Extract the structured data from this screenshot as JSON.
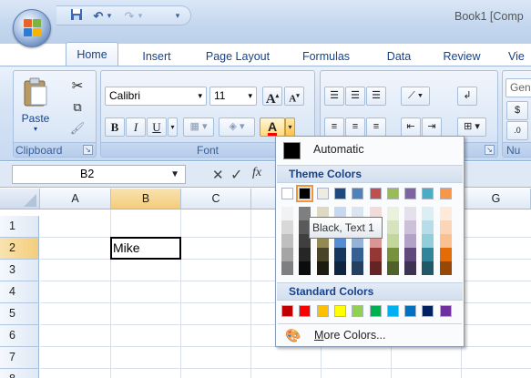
{
  "window": {
    "title": "Book1 [Comp"
  },
  "qat": {
    "save_icon": "save-icon",
    "undo_arrow": "▾",
    "redo_arrow": "▾",
    "customize": "▾"
  },
  "tabs": [
    "Home",
    "Insert",
    "Page Layout",
    "Formulas",
    "Data",
    "Review",
    "Vie"
  ],
  "clipboard": {
    "paste_label": "Paste",
    "group_label": "Clipboard"
  },
  "font": {
    "name": "Calibri",
    "size": "11",
    "bold": "B",
    "italic": "I",
    "underline": "U",
    "grow": "A",
    "shrink": "A",
    "color_glyph": "A",
    "group_label": "Font",
    "font_color": "#ff0000"
  },
  "number": {
    "format_value": "Gen",
    "group_label": "Nu"
  },
  "formula_bar": {
    "name_box": "B2",
    "fx": "fx"
  },
  "grid": {
    "columns": [
      "A",
      "B",
      "C",
      "D",
      "E",
      "F",
      "G"
    ],
    "rows": [
      "1",
      "2",
      "3",
      "4",
      "5",
      "6",
      "7",
      "8"
    ],
    "b2_value": "Mike"
  },
  "color_menu": {
    "automatic_label": "Automatic",
    "theme_header": "Theme Colors",
    "standard_header": "Standard Colors",
    "more_colors_label": "More Colors...",
    "more_colors_accel": "M",
    "more_colors_rest": "ore Colors...",
    "tooltip": "Black, Text 1",
    "theme_top": [
      "#ffffff",
      "#000000",
      "#eeece1",
      "#1f497d",
      "#4f81bd",
      "#c0504d",
      "#9bbb59",
      "#8064a2",
      "#4bacc6",
      "#f79646"
    ],
    "theme_shades": [
      [
        "#f2f2f2",
        "#d8d8d8",
        "#bfbfbf",
        "#a5a5a5",
        "#7f7f7f"
      ],
      [
        "#7f7f7f",
        "#595959",
        "#3f3f3f",
        "#262626",
        "#0c0c0c"
      ],
      [
        "#ddd9c3",
        "#c4bd97",
        "#938953",
        "#494429",
        "#1d1b10"
      ],
      [
        "#c6d9f0",
        "#8db3e2",
        "#548dd4",
        "#17365d",
        "#0f243e"
      ],
      [
        "#dbe5f1",
        "#b8cce4",
        "#95b3d7",
        "#366092",
        "#244061"
      ],
      [
        "#f2dcdb",
        "#e5b9b7",
        "#d99694",
        "#953734",
        "#632423"
      ],
      [
        "#ebf1dd",
        "#d7e3bc",
        "#c3d69b",
        "#76923c",
        "#4f6128"
      ],
      [
        "#e5e0ec",
        "#ccc1d9",
        "#b2a2c7",
        "#5f497a",
        "#3f3151"
      ],
      [
        "#dbeef3",
        "#b7dde8",
        "#92cddc",
        "#31859b",
        "#205867"
      ],
      [
        "#fdeada",
        "#fbd5b5",
        "#fac08f",
        "#e36c09",
        "#974806"
      ]
    ],
    "standard": [
      "#c00000",
      "#ff0000",
      "#ffc000",
      "#ffff00",
      "#92d050",
      "#00b050",
      "#00b0f0",
      "#0070c0",
      "#002060",
      "#7030a0"
    ],
    "selected_index": 1
  }
}
